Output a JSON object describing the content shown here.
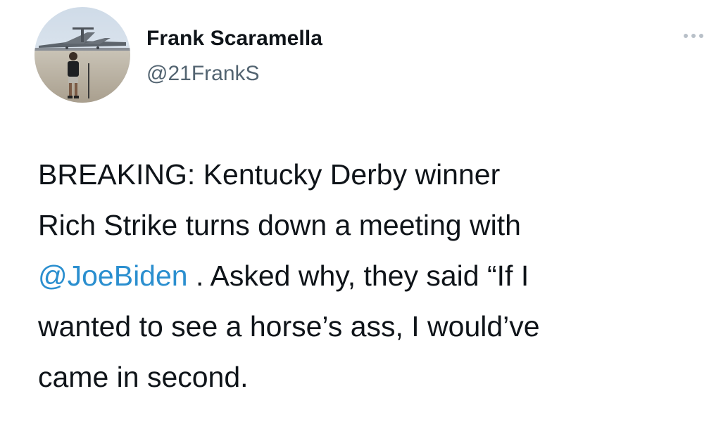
{
  "author": {
    "display_name": "Frank Scaramella",
    "handle": "@21FrankS",
    "avatar_icon": "profile-photo-person-with-airplane"
  },
  "header": {
    "more_icon": "more-options-icon"
  },
  "tweet": {
    "line1": "BREAKING: Kentucky Derby winner",
    "line2": "Rich Strike turns down a meeting with",
    "mention": "@JoeBiden",
    "line3_after_mention": " . Asked why, they said “If I",
    "line4": "wanted to see a horse’s ass, I would’ve",
    "line5": "came in second."
  },
  "colors": {
    "text": "#0f1419",
    "secondary": "#536471",
    "mention": "#2b8fcf",
    "background": "#ffffff"
  }
}
